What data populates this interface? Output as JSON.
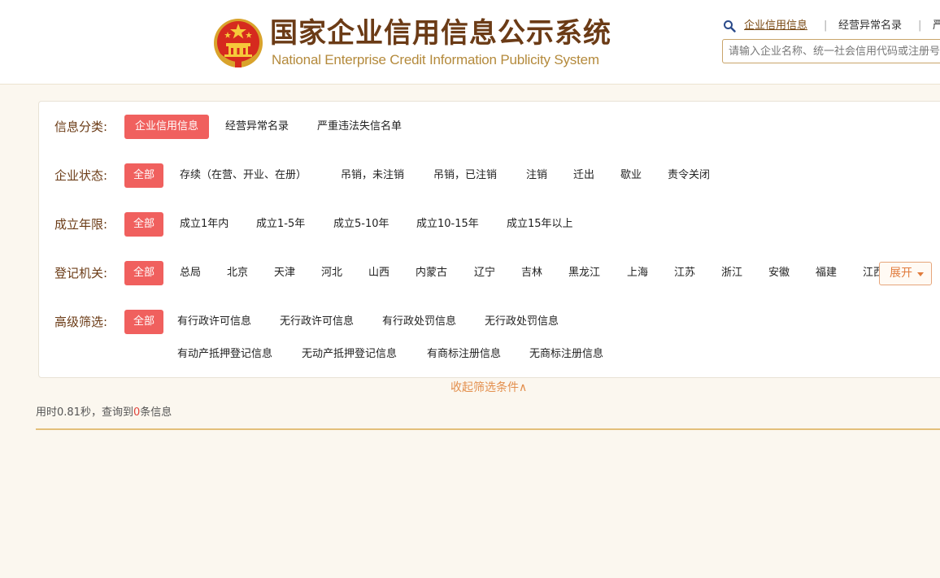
{
  "header": {
    "title_zh": "国家企业信用信息公示系统",
    "title_en": "National Enterprise Credit Information Publicity System",
    "emblem_icon": "national-emblem-icon",
    "nav": [
      {
        "label": "企业信用信息",
        "active": true
      },
      {
        "label": "经营异常名录",
        "active": false
      },
      {
        "label": "严",
        "active": false
      }
    ],
    "search": {
      "placeholder": "请输入企业名称、统一社会信用代码或注册号",
      "value": ""
    }
  },
  "filters": {
    "category": {
      "label": "信息分类:",
      "options": [
        "企业信用信息",
        "经营异常名录",
        "严重违法失信名单"
      ],
      "selected": 0
    },
    "status": {
      "label": "企业状态:",
      "options": [
        "全部",
        "存续（在营、开业、在册）",
        "吊销，未注销",
        "吊销，已注销",
        "注销",
        "迁出",
        "歇业",
        "责令关闭"
      ],
      "selected": 0
    },
    "years": {
      "label": "成立年限:",
      "options": [
        "全部",
        "成立1年内",
        "成立1-5年",
        "成立5-10年",
        "成立10-15年",
        "成立15年以上"
      ],
      "selected": 0
    },
    "authority": {
      "label": "登记机关:",
      "options": [
        "全部",
        "总局",
        "北京",
        "天津",
        "河北",
        "山西",
        "内蒙古",
        "辽宁",
        "吉林",
        "黑龙江",
        "上海",
        "江苏",
        "浙江",
        "安徽",
        "福建",
        "江西"
      ],
      "selected": 0,
      "expand_label": "展开"
    },
    "advanced": {
      "label": "高级筛选:",
      "options": [
        "全部",
        "有行政许可信息",
        "无行政许可信息",
        "有行政处罚信息",
        "无行政处罚信息",
        "有动产抵押登记信息",
        "无动产抵押登记信息",
        "有商标注册信息",
        "无商标注册信息"
      ],
      "selected": 0
    }
  },
  "collapse_label": "收起筛选条件∧",
  "result": {
    "prefix": "用时0.81秒，查询到",
    "count": "0",
    "suffix": "条信息"
  },
  "colors": {
    "accent_red": "#f0605e",
    "brand_brown": "#6b3b16",
    "gold": "#b48a3c",
    "orange": "#e38f4d"
  }
}
